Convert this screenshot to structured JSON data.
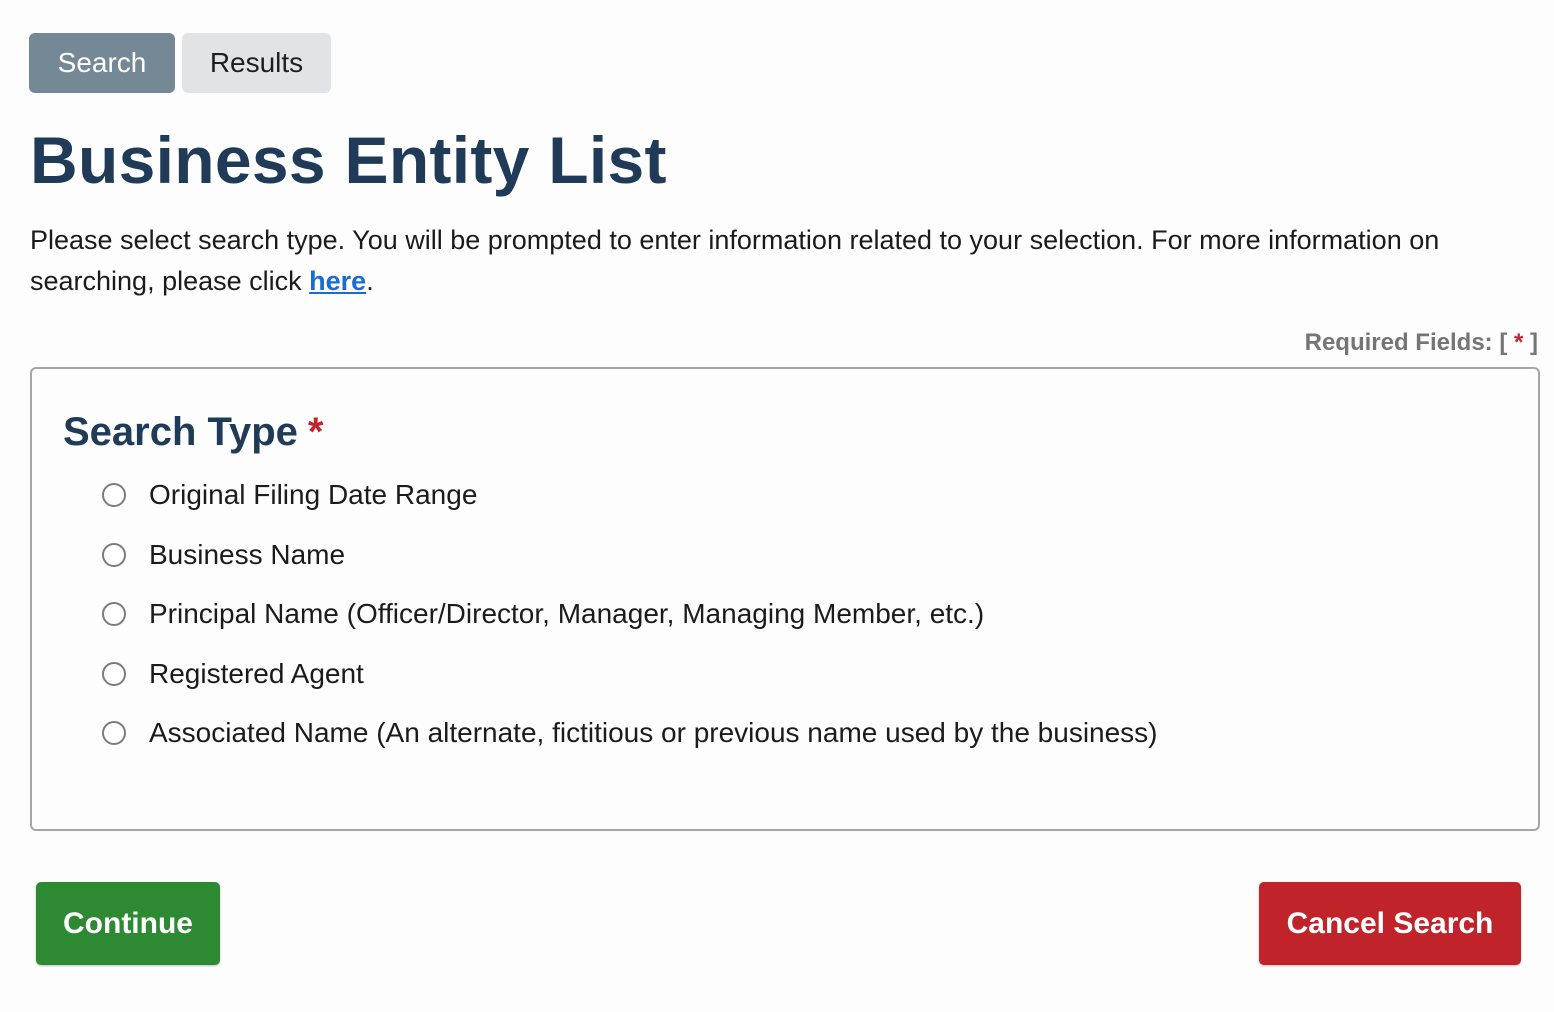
{
  "tabs": [
    {
      "label": "Search",
      "active": true
    },
    {
      "label": "Results",
      "active": false
    }
  ],
  "page_title": "Business Entity List",
  "intro": {
    "text_before": "Please select search type. You will be prompted to enter information related to your selection. For more information on searching, please click ",
    "link_text": "here",
    "text_after": "."
  },
  "required_note": {
    "prefix": "Required Fields: [ ",
    "star": "*",
    "suffix": " ]"
  },
  "search_type": {
    "legend": "Search Type",
    "required_star": "*",
    "options": [
      {
        "label": "Original Filing Date Range",
        "selected": false
      },
      {
        "label": "Business Name",
        "selected": false
      },
      {
        "label": "Principal Name (Officer/Director, Manager, Managing Member, etc.)",
        "selected": false
      },
      {
        "label": "Registered Agent",
        "selected": false
      },
      {
        "label": "Associated Name (An alternate, fictitious or previous name used by the business)",
        "selected": false
      }
    ]
  },
  "buttons": {
    "continue_label": "Continue",
    "cancel_label": "Cancel Search"
  },
  "colors": {
    "title": "#1f3b57",
    "link": "#1a6bd6",
    "required": "#c0262d",
    "continue": "#2d8a33",
    "cancel": "#c0232a",
    "active_tab": "#758896"
  }
}
